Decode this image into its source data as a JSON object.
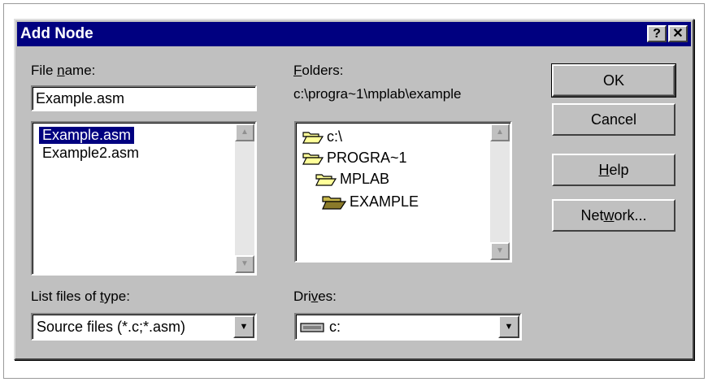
{
  "dialog": {
    "title": "Add Node",
    "help_glyph": "?",
    "close_glyph": "✕"
  },
  "file_name": {
    "label_pre": "File ",
    "label_key": "n",
    "label_post": "ame:",
    "value": "Example.asm"
  },
  "file_list": {
    "items": [
      "Example.asm",
      "Example2.asm"
    ],
    "selected_index": 0
  },
  "folders": {
    "label_key": "F",
    "label_post": "olders:",
    "path": "c:\\progra~1\\mplab\\example",
    "tree": [
      "c:\\",
      "PROGRA~1",
      "MPLAB",
      "EXAMPLE"
    ]
  },
  "file_type": {
    "label_pre": "List files of ",
    "label_key": "t",
    "label_post": "ype:",
    "value": "Source files (*.c;*.asm)"
  },
  "drives": {
    "label_pre": "Dri",
    "label_key": "v",
    "label_post": "es:",
    "value": "c:"
  },
  "buttons": {
    "ok": "OK",
    "cancel": "Cancel",
    "help_key": "H",
    "help_post": "elp",
    "network_pre": "Net",
    "network_key": "w",
    "network_post": "ork..."
  },
  "colors": {
    "titlebar": "#000080",
    "face": "#c0c0c0",
    "selection": "#000080",
    "folder_closed": "#ffff99",
    "folder_open": "#c8b84a"
  }
}
